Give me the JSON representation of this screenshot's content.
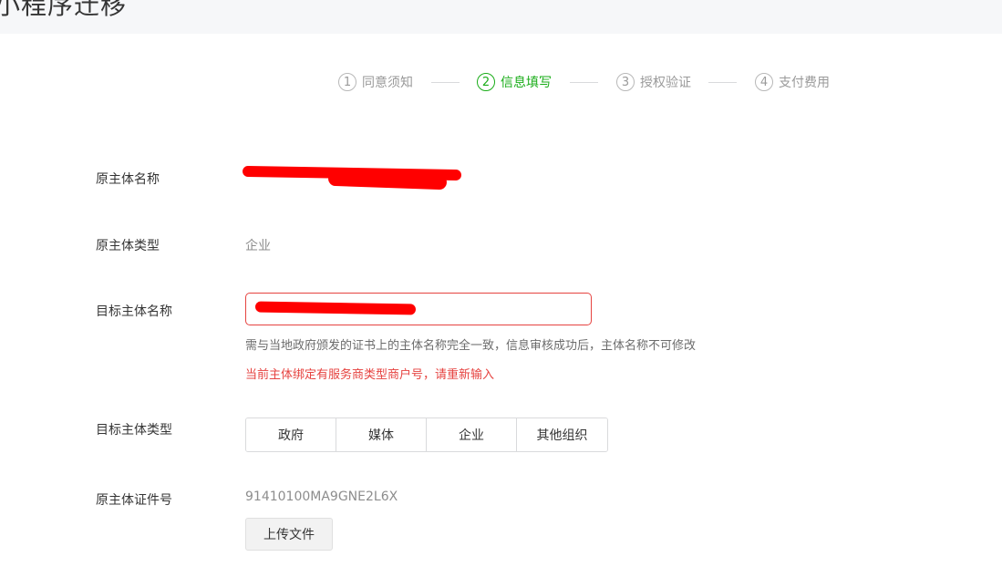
{
  "header": {
    "title": "小程序迁移"
  },
  "steps": [
    {
      "num": "1",
      "label": "同意须知",
      "active": false
    },
    {
      "num": "2",
      "label": "信息填写",
      "active": true
    },
    {
      "num": "3",
      "label": "授权验证",
      "active": false
    },
    {
      "num": "4",
      "label": "支付费用",
      "active": false
    }
  ],
  "form": {
    "original_name": {
      "label": "原主体名称",
      "value": ""
    },
    "original_type": {
      "label": "原主体类型",
      "value": "企业"
    },
    "target_name": {
      "label": "目标主体名称",
      "value": "",
      "hint": "需与当地政府颁发的证书上的主体名称完全一致，信息审核成功后，主体名称不可修改",
      "error": "当前主体绑定有服务商类型商户号，请重新输入"
    },
    "target_type": {
      "label": "目标主体类型",
      "options": [
        "政府",
        "媒体",
        "企业",
        "其他组织"
      ]
    },
    "original_cert": {
      "label": "原主体证件号",
      "value": "91410100MA9GNE2L6X",
      "upload_label": "上传文件"
    }
  },
  "colors": {
    "accent": "#1aad19",
    "error": "#e64340",
    "redaction": "#ff0000"
  }
}
